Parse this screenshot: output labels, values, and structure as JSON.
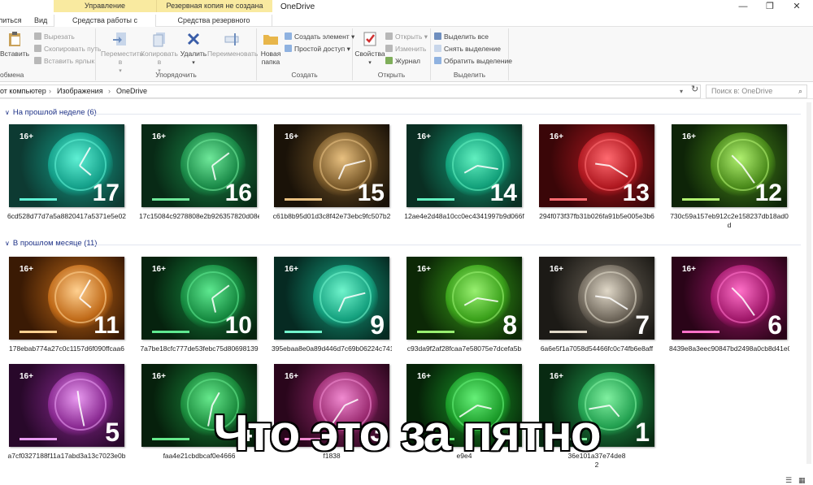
{
  "window": {
    "title": "OneDrive",
    "controls": {
      "minimize": "—",
      "maximize": "❐",
      "close": "✕"
    }
  },
  "context_groups": {
    "manage": "Управление",
    "backup_warning": "Резервная копия не создана"
  },
  "tabs": {
    "share": "литься",
    "view": "Вид",
    "picture_tools": "Средства работы с рисунками",
    "backup_tools": "Средства резервного копирования"
  },
  "ribbon": {
    "clipboard": {
      "label": "обмена",
      "paste": "Вставить",
      "cut": "Вырезать",
      "copy_path": "Скопировать путь",
      "paste_shortcut": "Вставить ярлык"
    },
    "organize": {
      "label": "Упорядочить",
      "move": "Переместить в",
      "copy": "Копировать в",
      "delete": "Удалить",
      "rename": "Переименовать"
    },
    "create": {
      "label": "Создать",
      "new_folder_l1": "Новая",
      "new_folder_l2": "папка",
      "new_item": "Создать элемент",
      "easy_access": "Простой доступ"
    },
    "open": {
      "label": "Открыть",
      "properties": "Свойства",
      "open": "Открыть",
      "edit": "Изменить",
      "history": "Журнал"
    },
    "select": {
      "label": "Выделить",
      "select_all": "Выделить все",
      "select_none": "Снять выделение",
      "invert": "Обратить выделение"
    }
  },
  "address": {
    "crumbs": [
      "от компьютер",
      "Изображения",
      "OneDrive"
    ],
    "separator": "›",
    "search_placeholder": "Поиск в: OneDrive"
  },
  "groups": [
    {
      "header": "На прошлой неделе (6)",
      "items": [
        {
          "number": "17",
          "name": "6cd528d77d7a5a8820417a5371e5e02",
          "age": "16+",
          "palette": [
            "#0d3a32",
            "#14a08a",
            "#5ff0d4"
          ]
        },
        {
          "number": "16",
          "name": "17c15084c9278808e2b926357820d08e",
          "age": "16+",
          "palette": [
            "#082a16",
            "#1a8a48",
            "#6fe89a"
          ]
        },
        {
          "number": "15",
          "name": "c61b8b95d01d3c8f42e73ebc9fc507b2",
          "age": "16+",
          "palette": [
            "#1a1208",
            "#7a5a2a",
            "#e8c080"
          ]
        },
        {
          "number": "14",
          "name": "12ae4e2d48a10cc0ec4341997b9d066f",
          "age": "16+",
          "palette": [
            "#0a2e22",
            "#12a07a",
            "#62f0c0"
          ]
        },
        {
          "number": "13",
          "name": "294f073f37fb31b026fa91b5e005e3b6",
          "age": "16+",
          "palette": [
            "#3a0608",
            "#b01820",
            "#ff6a70"
          ]
        },
        {
          "number": "12",
          "name": "730c59a157eb912c2e158237db18ad0",
          "name2": "d",
          "age": "16+",
          "palette": [
            "#0e2408",
            "#4a8a1a",
            "#b0f070"
          ]
        }
      ]
    },
    {
      "header": "В прошлом месяце (11)",
      "items": [
        {
          "number": "11",
          "name": "178ebab774a27c0c1157d6f090ffcaa6",
          "age": "16+",
          "palette": [
            "#3a1a04",
            "#c06a18",
            "#ffd090"
          ]
        },
        {
          "number": "10",
          "name": "7a7be18cfc777de53febc75d80698139",
          "age": "16+",
          "palette": [
            "#06220e",
            "#168a40",
            "#5ee890"
          ]
        },
        {
          "number": "9",
          "name": "395ebaa8e0a89d446d7c69b06224c741",
          "age": "16+",
          "palette": [
            "#062a22",
            "#14a07e",
            "#70f4cc"
          ]
        },
        {
          "number": "8",
          "name": "c93da9f2af28fcaa7e58075e7dcefa5b",
          "age": "16+",
          "palette": [
            "#0c2806",
            "#3aa01a",
            "#98f070"
          ]
        },
        {
          "number": "7",
          "name": "6a6e5f1a7058d54466fc0c74fb6e8aff",
          "age": "16+",
          "palette": [
            "#1c1a16",
            "#6e665a",
            "#e0d8c8"
          ]
        },
        {
          "number": "6",
          "name": "8439e8a3eec90847bd2498a0cb8d41e0",
          "age": "16+",
          "palette": [
            "#2a0418",
            "#a0186a",
            "#ff70c8"
          ]
        },
        {
          "number": "5",
          "name": "a7cf0327188f11a17abd3a13c7023e0b",
          "age": "16+",
          "palette": [
            "#28082a",
            "#8a2a92",
            "#e89af0"
          ]
        },
        {
          "number": "4",
          "name": "faa4e21cbdbcaf0e4666",
          "age": "16+",
          "palette": [
            "#06200c",
            "#1a8a3c",
            "#66e88c"
          ]
        },
        {
          "number": "3",
          "name": "f1838",
          "age": "16+",
          "palette": [
            "#2a061c",
            "#9a2a70",
            "#f08ad0"
          ]
        },
        {
          "number": "2",
          "name": "e9e4",
          "age": "16+",
          "palette": [
            "#062208",
            "#1a9a28",
            "#66f078"
          ]
        },
        {
          "number": "1",
          "name": "36e101a37e74de8",
          "name2": "2",
          "age": "16+",
          "palette": [
            "#082a12",
            "#22a050",
            "#80f0a0"
          ]
        }
      ]
    }
  ],
  "caption": "Что это за пятно"
}
